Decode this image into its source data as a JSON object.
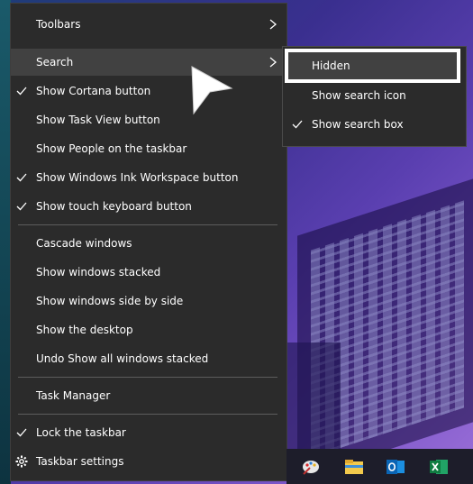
{
  "menu": {
    "items": [
      {
        "label": "Toolbars",
        "checked": false,
        "submenu": true
      },
      {
        "label": "Search",
        "checked": false,
        "submenu": true,
        "highlighted": true
      },
      {
        "label": "Show Cortana button",
        "checked": true
      },
      {
        "label": "Show Task View button",
        "checked": false
      },
      {
        "label": "Show People on the taskbar",
        "checked": false
      },
      {
        "label": "Show Windows Ink Workspace button",
        "checked": true
      },
      {
        "label": "Show touch keyboard button",
        "checked": true
      },
      {
        "label": "Cascade windows",
        "checked": false
      },
      {
        "label": "Show windows stacked",
        "checked": false
      },
      {
        "label": "Show windows side by side",
        "checked": false
      },
      {
        "label": "Show the desktop",
        "checked": false
      },
      {
        "label": "Undo Show all windows stacked",
        "checked": false
      },
      {
        "label": "Task Manager",
        "checked": false
      },
      {
        "label": "Lock the taskbar",
        "checked": true
      },
      {
        "label": "Taskbar settings",
        "icon": "gear-icon"
      }
    ]
  },
  "search_submenu": {
    "items": [
      {
        "label": "Hidden",
        "highlighted": true,
        "checked": false
      },
      {
        "label": "Show search icon",
        "checked": false
      },
      {
        "label": "Show search box",
        "checked": true
      }
    ]
  },
  "taskbar": {
    "icons": [
      "paint-icon",
      "file-explorer-icon",
      "outlook-icon",
      "excel-icon"
    ]
  },
  "colors": {
    "menu_bg": "#2b2b2b",
    "menu_hover": "#414141",
    "separator": "#5d5d5d",
    "text": "#ffffff"
  }
}
